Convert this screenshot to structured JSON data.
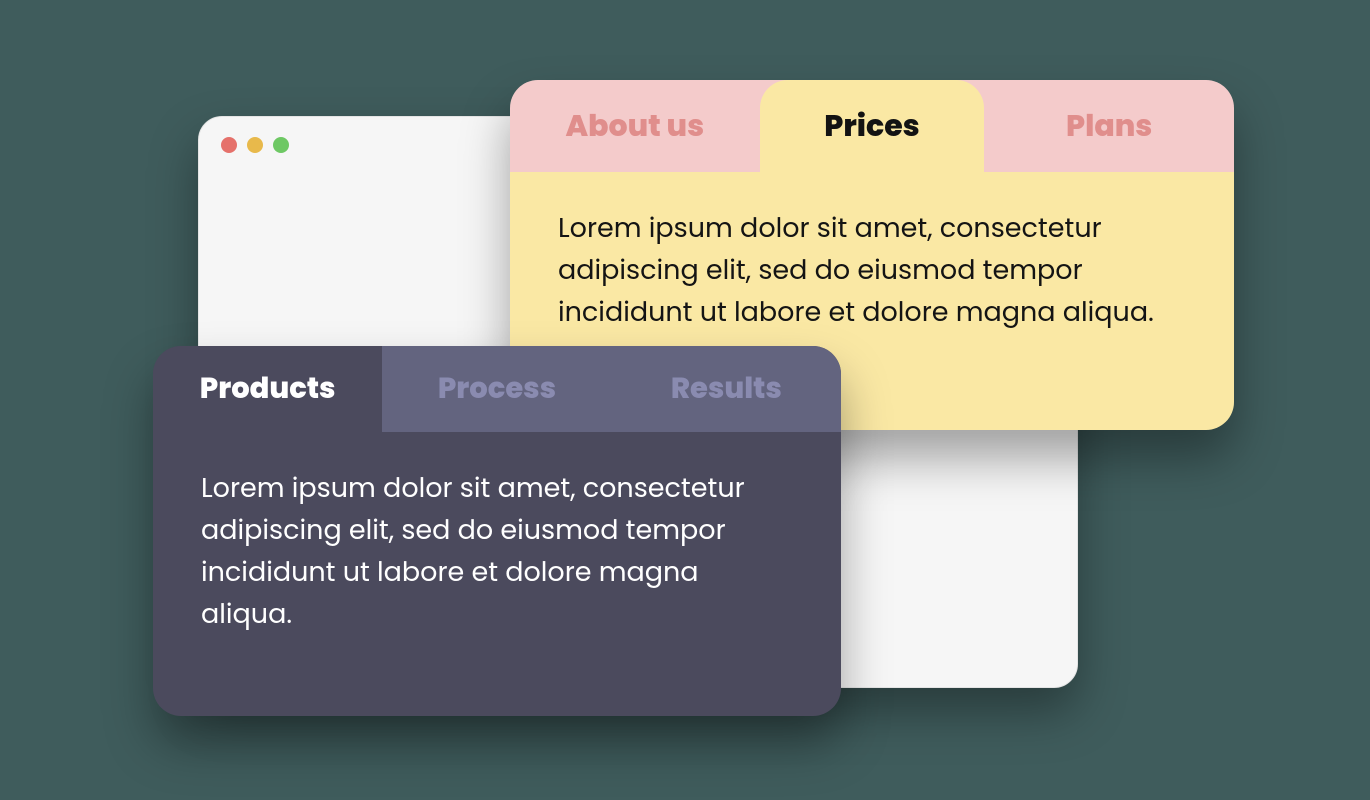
{
  "colors": {
    "background": "#3f5c5c",
    "light_tab_bg": "#f4cbcb",
    "light_active_bg": "#fae8a4",
    "light_inactive_text": "#e08e8c",
    "dark_card_bg": "#4b4a5d",
    "dark_inactive_bg": "#63647f",
    "dark_inactive_text": "#8a8bb0",
    "browser_bg": "#f6f6f6",
    "dot_red": "#e5716b",
    "dot_yellow": "#e8b94b",
    "dot_green": "#6ec864"
  },
  "browser_window": {
    "controls": [
      "close",
      "minimize",
      "maximize"
    ]
  },
  "light_card": {
    "tabs": [
      {
        "label": "About us",
        "active": false
      },
      {
        "label": "Prices",
        "active": true
      },
      {
        "label": "Plans",
        "active": false
      }
    ],
    "content": "Lorem ipsum dolor sit amet, consectetur adipiscing elit, sed do eiusmod tempor incididunt ut labore et dolore magna aliqua."
  },
  "dark_card": {
    "tabs": [
      {
        "label": "Products",
        "active": true
      },
      {
        "label": "Process",
        "active": false
      },
      {
        "label": "Results",
        "active": false
      }
    ],
    "content": "Lorem ipsum dolor sit amet, consectetur adipiscing elit, sed do eiusmod tempor incididunt ut labore et dolore magna aliqua."
  }
}
